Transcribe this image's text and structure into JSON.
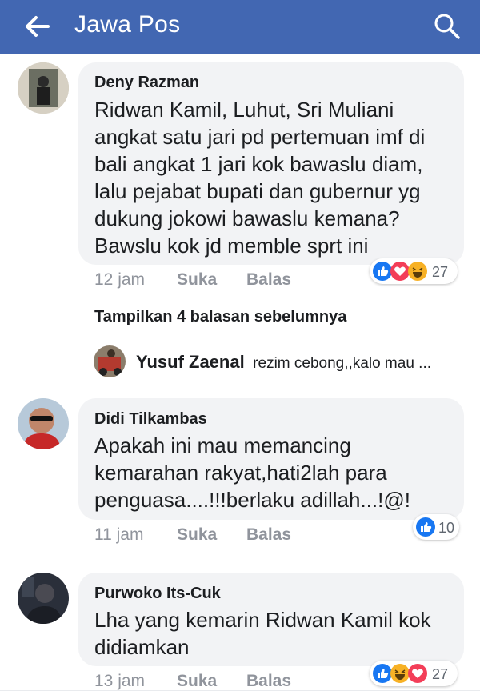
{
  "header": {
    "title": "Jawa Pos",
    "back_icon": "arrow-left-icon",
    "search_icon": "search-icon",
    "bg_color": "#4267b2"
  },
  "comments": [
    {
      "author": "Deny Razman",
      "text": "Ridwan Kamil, Luhut, Sri Muliani\nangkat satu jari pd pertemuan imf di\nbali angkat 1 jari kok bawaslu diam,\nlalu pejabat bupati dan gubernur yg\ndukung jokowi bawaslu kemana?\nBawslu kok jd memble sprt ini",
      "time": "12 jam",
      "like_label": "Suka",
      "reply_label": "Balas",
      "reaction_count": "27",
      "reaction_icons": [
        "like-icon",
        "love-icon",
        "haha-icon"
      ]
    },
    {
      "author": "Didi Tilkambas",
      "text": "Apakah ini mau memancing\nkemarahan rakyat,hati2lah para\npenguasa....!!!berlaku adillah...!@!",
      "time": "11 jam",
      "like_label": "Suka",
      "reply_label": "Balas",
      "reaction_count": "10",
      "reaction_icons": [
        "like-icon"
      ]
    },
    {
      "author": "Purwoko Its-Cuk",
      "text": "Lha yang kemarin Ridwan Kamil kok\ndidiamkan",
      "time": "13 jam",
      "like_label": "Suka",
      "reply_label": "Balas",
      "reaction_count": "27",
      "reaction_icons": [
        "like-icon",
        "haha-icon",
        "love-icon"
      ]
    }
  ],
  "replies_section": {
    "show_previous": "Tampilkan 4 balasan sebelumnya",
    "reply_author": "Yusuf Zaenal",
    "reply_preview": "rezim cebong,,kalo mau ..."
  },
  "colors": {
    "like": "#1877f2",
    "love": "#f33e58",
    "haha": "#f7b125"
  }
}
